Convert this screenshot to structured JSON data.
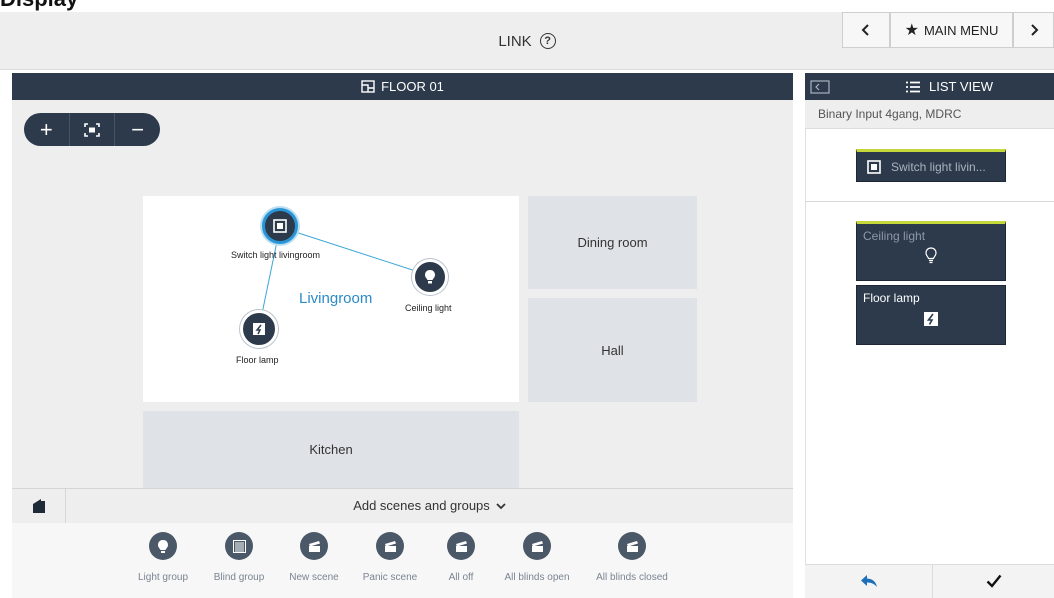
{
  "header": {
    "clipped_title": "Display",
    "title": "LINK",
    "help_icon": "help-circle-icon",
    "back_icon": "chevron-left-icon",
    "main_menu_label": "MAIN MENU",
    "main_menu_icon": "star-icon",
    "forward_icon": "chevron-right-icon"
  },
  "floor": {
    "title": "FLOOR 01",
    "title_icon": "floor-plan-icon",
    "zoom": {
      "in_icon": "plus-icon",
      "fit_icon": "fit-screen-icon",
      "out_icon": "minus-icon"
    },
    "rooms": {
      "livingroom": "Livingroom",
      "dining": "Dining room",
      "hall": "Hall",
      "kitchen": "Kitchen"
    },
    "devices": {
      "switch": "Switch light livingroom",
      "ceiling": "Ceiling light",
      "floor_lamp": "Floor lamp"
    }
  },
  "scenes": {
    "home_icon": "house-icon",
    "add_label": "Add scenes and groups",
    "chevron_icon": "chevron-down-icon",
    "tools": [
      {
        "label": "Light group",
        "icon": "bulb-icon"
      },
      {
        "label": "Blind group",
        "icon": "blind-icon"
      },
      {
        "label": "New scene",
        "icon": "clapper-icon"
      },
      {
        "label": "Panic scene",
        "icon": "clapper-icon"
      },
      {
        "label": "All off",
        "icon": "clapper-icon"
      },
      {
        "label": "All blinds open",
        "icon": "clapper-icon"
      },
      {
        "label": "All blinds closed",
        "icon": "clapper-icon"
      }
    ]
  },
  "right_panel": {
    "collapse_icon": "panel-collapse-icon",
    "title": "LIST VIEW",
    "title_icon": "list-icon",
    "device_name": "Binary Input 4gang, MDRC",
    "channel_label": "Switch light livin...",
    "linked": [
      {
        "label": "Ceiling light",
        "icon": "bulb-outline-icon"
      },
      {
        "label": "Floor lamp",
        "icon": "dimmer-icon"
      }
    ],
    "back_icon": "reply-arrow-icon",
    "confirm_icon": "check-icon"
  },
  "colors": {
    "navy": "#2c3a4c",
    "selection_blue": "#2a95d5",
    "accent_yellow": "#c5d83a"
  }
}
